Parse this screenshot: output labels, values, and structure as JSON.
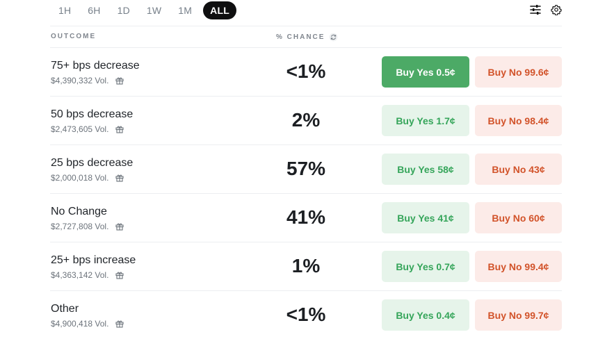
{
  "range_tabs": [
    "1H",
    "6H",
    "1D",
    "1W",
    "1M",
    "ALL"
  ],
  "active_range": "ALL",
  "columns": {
    "outcome": "OUTCOME",
    "chance": "% CHANCE"
  },
  "icons": {
    "filter": "sliders-icon",
    "settings": "gear-icon",
    "refresh": "refresh-icon",
    "gift": "gift-icon"
  },
  "colors": {
    "yes_solid": "#4caa66",
    "yes_light": "#e6f4ea",
    "no_light": "#fcebe8",
    "no_text": "#d2532a"
  },
  "rows": [
    {
      "name": "75+ bps decrease",
      "volume": "$4,390,332 Vol.",
      "chance": "<1%",
      "yes": "Buy Yes 0.5¢",
      "no": "Buy No 99.6¢"
    },
    {
      "name": "50 bps decrease",
      "volume": "$2,473,605 Vol.",
      "chance": "2%",
      "yes": "Buy Yes 1.7¢",
      "no": "Buy No 98.4¢"
    },
    {
      "name": "25 bps decrease",
      "volume": "$2,000,018 Vol.",
      "chance": "57%",
      "yes": "Buy Yes 58¢",
      "no": "Buy No 43¢"
    },
    {
      "name": "No Change",
      "volume": "$2,727,808 Vol.",
      "chance": "41%",
      "yes": "Buy Yes 41¢",
      "no": "Buy No 60¢"
    },
    {
      "name": "25+ bps increase",
      "volume": "$4,363,142 Vol.",
      "chance": "1%",
      "yes": "Buy Yes 0.7¢",
      "no": "Buy No 99.4¢"
    },
    {
      "name": "Other",
      "volume": "$4,900,418 Vol.",
      "chance": "<1%",
      "yes": "Buy Yes 0.4¢",
      "no": "Buy No 99.7¢"
    }
  ]
}
